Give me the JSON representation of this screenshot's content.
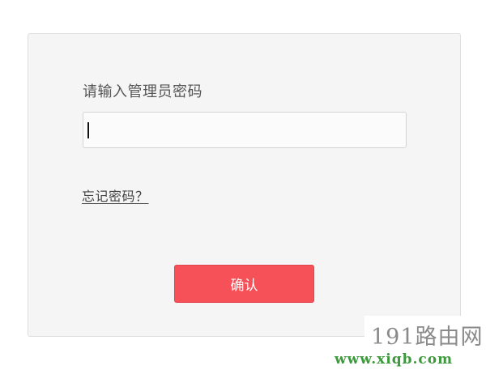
{
  "login": {
    "prompt_label": "请输入管理员密码",
    "password_value": "",
    "forgot_link": "忘记密码？",
    "confirm_button": "确认"
  },
  "colors": {
    "accent": "#f65058",
    "panel_bg": "#f5f5f5"
  },
  "watermark": {
    "title": "191路由网",
    "url": "www.xiqb.com"
  }
}
